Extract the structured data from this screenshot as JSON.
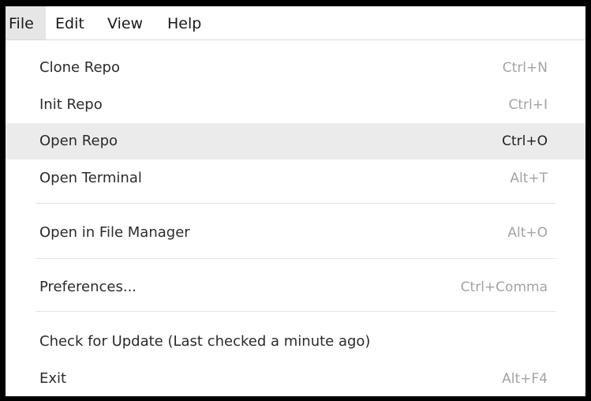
{
  "menubar": {
    "items": [
      {
        "label": "File"
      },
      {
        "label": "Edit"
      },
      {
        "label": "View"
      },
      {
        "label": "Help"
      }
    ]
  },
  "file_menu": {
    "items": [
      {
        "label": "Clone Repo",
        "shortcut": "Ctrl+N"
      },
      {
        "label": "Init Repo",
        "shortcut": "Ctrl+I"
      },
      {
        "label": "Open Repo",
        "shortcut": "Ctrl+O"
      },
      {
        "label": "Open Terminal",
        "shortcut": "Alt+T"
      },
      {
        "label": "Open in File Manager",
        "shortcut": "Alt+O"
      },
      {
        "label": "Preferences...",
        "shortcut": "Ctrl+Comma"
      },
      {
        "label": "Check for Update (Last checked a minute ago)",
        "shortcut": ""
      },
      {
        "label": "Exit",
        "shortcut": "Alt+F4"
      }
    ]
  }
}
